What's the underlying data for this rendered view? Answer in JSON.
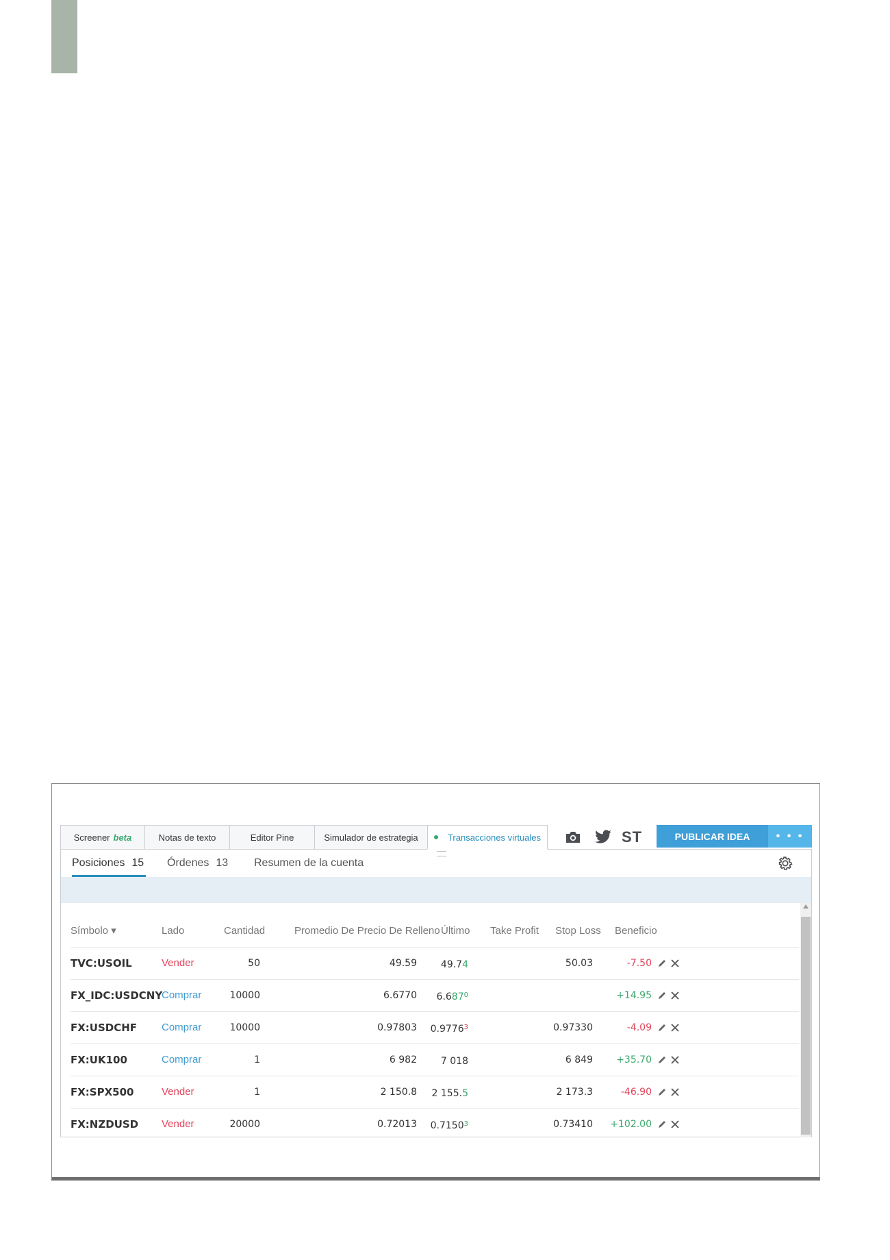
{
  "tabs": [
    {
      "label": "Screener",
      "badge": "beta"
    },
    {
      "label": "Notas de texto"
    },
    {
      "label": "Editor Pine"
    },
    {
      "label": "Simulador de estrategia"
    },
    {
      "label": "Transacciones virtuales"
    }
  ],
  "toolbar": {
    "camera_icon": "camera-icon",
    "twitter_icon": "twitter-icon",
    "st_label": "ST",
    "publish_label": "PUBLICAR IDEA",
    "more_label": "• • •"
  },
  "subtabs": {
    "positions_label": "Posiciones",
    "positions_count": "15",
    "orders_label": "Órdenes",
    "orders_count": "13",
    "summary_label": "Resumen de la cuenta"
  },
  "table": {
    "headers": {
      "symbol": "Símbolo ▾",
      "side": "Lado",
      "qty": "Cantidad",
      "avg": "Promedio De Precio De Relleno",
      "last": "Último",
      "tp": "Take Profit",
      "sl": "Stop Loss",
      "profit": "Beneficio"
    },
    "rows": [
      {
        "symbol": "TVC:USOIL",
        "side": "Vender",
        "qty": "50",
        "avg": "49.59",
        "last_main": "49.7",
        "last_hi": "4",
        "last_sup": "",
        "tp": "",
        "sl": "50.03",
        "profit": "-7.50"
      },
      {
        "symbol": "FX_IDC:USDCNY",
        "side": "Comprar",
        "qty": "10000",
        "avg": "6.6770",
        "last_main": "6.6",
        "last_hi": "87",
        "last_sup": "0",
        "tp": "",
        "sl": "",
        "profit": "+14.95"
      },
      {
        "symbol": "FX:USDCHF",
        "side": "Comprar",
        "qty": "10000",
        "avg": "0.97803",
        "last_main": "0.9776",
        "last_hi": "",
        "last_sup": "3",
        "tp": "",
        "sl": "0.97330",
        "profit": "-4.09"
      },
      {
        "symbol": "FX:UK100",
        "side": "Comprar",
        "qty": "1",
        "avg": "6 982",
        "last_main": "7 018",
        "last_hi": "",
        "last_sup": "",
        "tp": "",
        "sl": "6 849",
        "profit": "+35.70"
      },
      {
        "symbol": "FX:SPX500",
        "side": "Vender",
        "qty": "1",
        "avg": "2 150.8",
        "last_main": "2 155.",
        "last_hi": "5",
        "last_sup": "",
        "tp": "",
        "sl": "2 173.3",
        "profit": "-46.90"
      },
      {
        "symbol": "FX:NZDUSD",
        "side": "Vender",
        "qty": "20000",
        "avg": "0.72013",
        "last_main": "0.7150",
        "last_hi": "",
        "last_sup": "3",
        "tp": "",
        "sl": "0.73410",
        "profit": "+102.00"
      }
    ]
  },
  "colors": {
    "buy": "#3d9ad0",
    "sell": "#e2435a",
    "gain": "#3aa86d",
    "loss": "#e2435a",
    "accent": "#3f9fd8"
  }
}
